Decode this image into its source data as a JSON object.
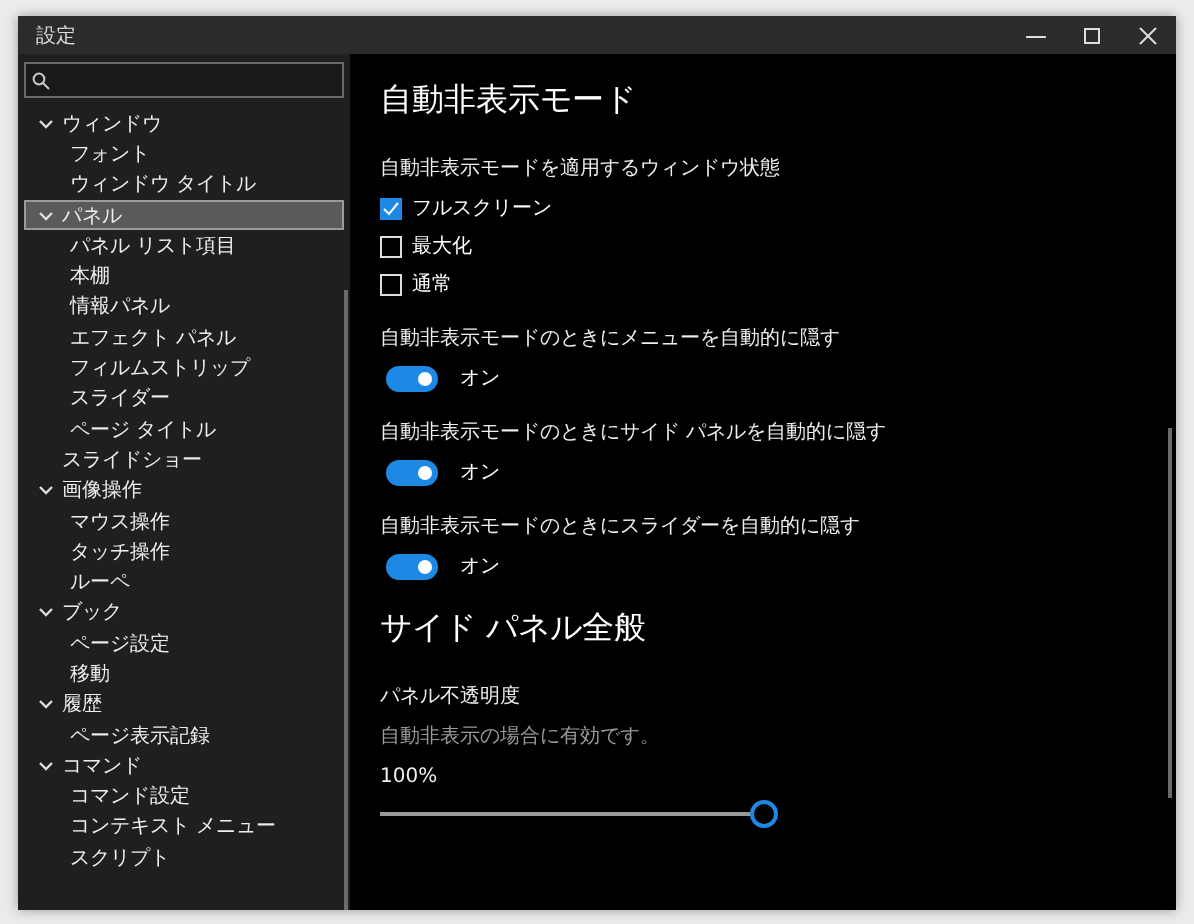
{
  "window": {
    "title": "設定"
  },
  "tree": [
    {
      "label": "ウィンドウ",
      "expanded": true,
      "selected": false,
      "children": [
        {
          "label": "フォント",
          "selected": false
        },
        {
          "label": "ウィンドウ タイトル",
          "selected": false
        }
      ]
    },
    {
      "label": "パネル",
      "expanded": true,
      "selected": true,
      "children": [
        {
          "label": "パネル リスト項目",
          "selected": false
        },
        {
          "label": "本棚",
          "selected": false
        },
        {
          "label": "情報パネル",
          "selected": false
        },
        {
          "label": "エフェクト パネル",
          "selected": false
        },
        {
          "label": "フィルムストリップ",
          "selected": false
        },
        {
          "label": "スライダー",
          "selected": false
        },
        {
          "label": "ページ タイトル",
          "selected": false
        }
      ]
    },
    {
      "label": "スライドショー",
      "selected": false
    },
    {
      "label": "画像操作",
      "expanded": true,
      "selected": false,
      "children": [
        {
          "label": "マウス操作",
          "selected": false
        },
        {
          "label": "タッチ操作",
          "selected": false
        },
        {
          "label": "ルーペ",
          "selected": false
        }
      ]
    },
    {
      "label": "ブック",
      "expanded": true,
      "selected": false,
      "children": [
        {
          "label": "ページ設定",
          "selected": false
        },
        {
          "label": "移動",
          "selected": false
        }
      ]
    },
    {
      "label": "履歴",
      "expanded": true,
      "selected": false,
      "children": [
        {
          "label": "ページ表示記録",
          "selected": false
        }
      ]
    },
    {
      "label": "コマンド",
      "expanded": true,
      "selected": false,
      "children": [
        {
          "label": "コマンド設定",
          "selected": false
        },
        {
          "label": "コンテキスト メニュー",
          "selected": false
        },
        {
          "label": "スクリプト",
          "selected": false
        }
      ]
    }
  ],
  "sections": [
    {
      "title": "自動非表示モード",
      "settings": [
        {
          "kind": "checks",
          "label": "自動非表示モードを適用するウィンドウ状態",
          "options": [
            {
              "label": "フルスクリーン",
              "checked": true
            },
            {
              "label": "最大化",
              "checked": false
            },
            {
              "label": "通常",
              "checked": false
            }
          ]
        },
        {
          "kind": "toggle",
          "label": "自動非表示モードのときにメニューを自動的に隠す",
          "on": true,
          "state_text": "オン"
        },
        {
          "kind": "toggle",
          "label": "自動非表示モードのときにサイド パネルを自動的に隠す",
          "on": true,
          "state_text": "オン"
        },
        {
          "kind": "toggle",
          "label": "自動非表示モードのときにスライダーを自動的に隠す",
          "on": true,
          "state_text": "オン"
        }
      ]
    },
    {
      "title": "サイド パネル全般",
      "settings": [
        {
          "kind": "slider",
          "label": "パネル不透明度",
          "description": "自動非表示の場合に有効です。",
          "reading": "100%",
          "level": 1
        }
      ]
    }
  ]
}
